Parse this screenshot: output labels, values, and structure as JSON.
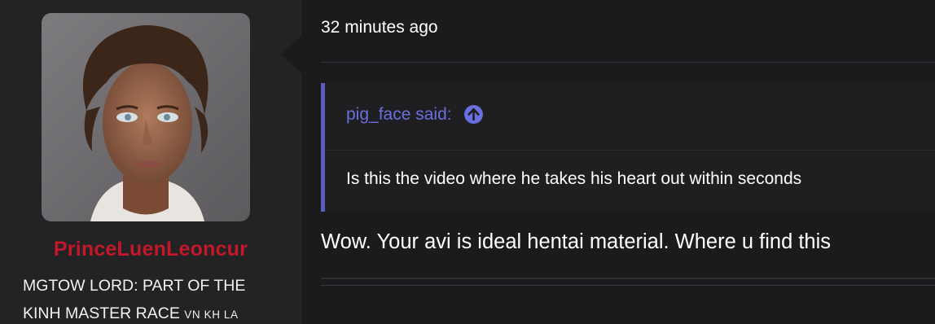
{
  "user": {
    "username": "PrinceLuenLeoncur",
    "title_main": "MGTOW LORD: PART OF THE KINH MASTER RACE",
    "title_suffix": "VN KH LA",
    "username_color": "#c3172a"
  },
  "post": {
    "timestamp": "32 minutes ago",
    "quote": {
      "author_line": "pig_face said:",
      "jump_icon": "arrow-up-circle-icon",
      "body": "Is this the video where he takes his heart out within seconds"
    },
    "message": "Wow. Your avi is ideal hentai material. Where u find this"
  },
  "colors": {
    "quote_accent": "#5a5fbd",
    "quote_link": "#6c6fe0",
    "background": "#1b1b1d"
  }
}
